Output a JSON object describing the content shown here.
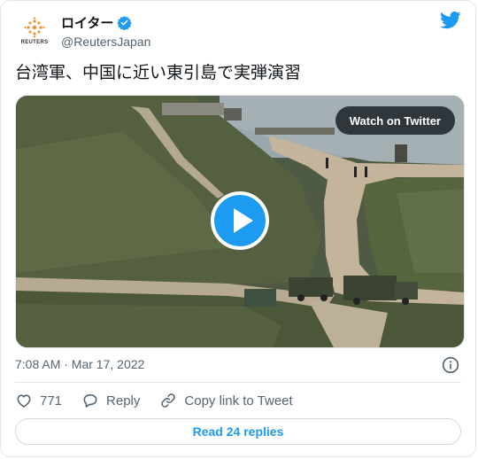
{
  "author": {
    "display_name": "ロイター",
    "handle": "@ReutersJapan",
    "avatar_logo_text": "REUTERS",
    "verified_icon": "verified-badge-icon"
  },
  "tweet": {
    "text": "台湾軍、中国に近い東引島で実弾演習",
    "timestamp": "7:08 AM · Mar 17, 2022"
  },
  "media": {
    "watch_label": "Watch on Twitter",
    "play_icon": "play-icon"
  },
  "actions": {
    "like_count": "771",
    "reply_label": "Reply",
    "copy_label": "Copy link to Tweet"
  },
  "footer": {
    "read_replies_label": "Read 24 replies"
  },
  "colors": {
    "accent": "#1d9bf0",
    "text": "#0f1419",
    "muted": "#536471",
    "border": "#e3e8ec"
  }
}
